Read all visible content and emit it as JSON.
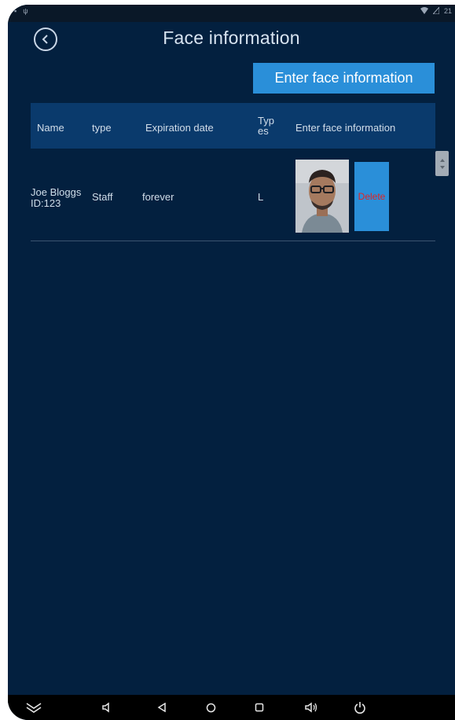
{
  "status_bar": {
    "time": "21"
  },
  "header": {
    "title": "Face information",
    "enter_button_label": "Enter face information"
  },
  "table": {
    "columns": {
      "name": "Name",
      "type": "type",
      "expiration": "Expiration date",
      "types": "Types",
      "face": "Enter face information"
    },
    "rows": [
      {
        "name": "Joe Bloggs",
        "id": "ID:123",
        "type": "Staff",
        "expiration": "forever",
        "types": "L",
        "delete_label": "Delete"
      }
    ]
  },
  "colors": {
    "background": "#03203f",
    "header_row": "#0a3a6c",
    "accent": "#2a8fd9",
    "delete_text": "#e02424"
  },
  "icons": [
    "back-icon",
    "wifi-icon",
    "signal-icon",
    "collapse-icon",
    "volume-down-icon",
    "nav-back-icon",
    "home-icon",
    "recents-icon",
    "volume-up-icon",
    "power-icon"
  ]
}
